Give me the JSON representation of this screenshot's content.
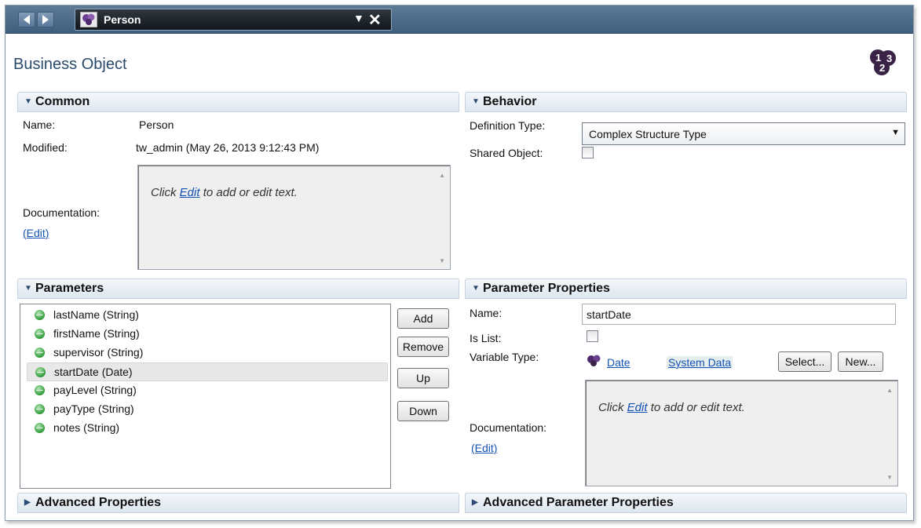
{
  "tab": {
    "label": "Person"
  },
  "page": {
    "title": "Business Object"
  },
  "common": {
    "header": "Common",
    "name_label": "Name:",
    "name_value": "Person",
    "modified_label": "Modified:",
    "modified_value": "tw_admin (May 26, 2013 9:12:43 PM)",
    "documentation_label": "Documentation:",
    "edit_link": "(Edit)",
    "doc_prefix": "Click",
    "doc_link": "Edit",
    "doc_suffix": "to add or edit text."
  },
  "behavior": {
    "header": "Behavior",
    "definition_type_label": "Definition Type:",
    "definition_type_value": "Complex Structure Type",
    "shared_object_label": "Shared Object:"
  },
  "parameters": {
    "header": "Parameters",
    "items": [
      "lastName (String)",
      "firstName (String)",
      "supervisor (String)",
      "startDate (Date)",
      "payLevel (String)",
      "payType (String)",
      "notes (String)"
    ],
    "selected_index": 3,
    "add": "Add",
    "remove": "Remove",
    "up": "Up",
    "down": "Down"
  },
  "param_props": {
    "header": "Parameter Properties",
    "name_label": "Name:",
    "name_value": "startDate",
    "is_list_label": "Is List:",
    "variable_type_label": "Variable Type:",
    "variable_type_link": "Date",
    "system_data_link": "System Data",
    "select_button": "Select...",
    "new_button": "New...",
    "documentation_label": "Documentation:",
    "edit_link": "(Edit)",
    "doc_prefix": "Click",
    "doc_link": "Edit",
    "doc_suffix": "to add or edit text."
  },
  "advanced": {
    "header": "Advanced Properties"
  },
  "advanced_param": {
    "header": "Advanced Parameter Properties"
  },
  "colors": {
    "title": "#2a4a6c",
    "link": "#1452b3",
    "tabbar": "#4a6a8a",
    "status_dot": "#3ea447"
  }
}
